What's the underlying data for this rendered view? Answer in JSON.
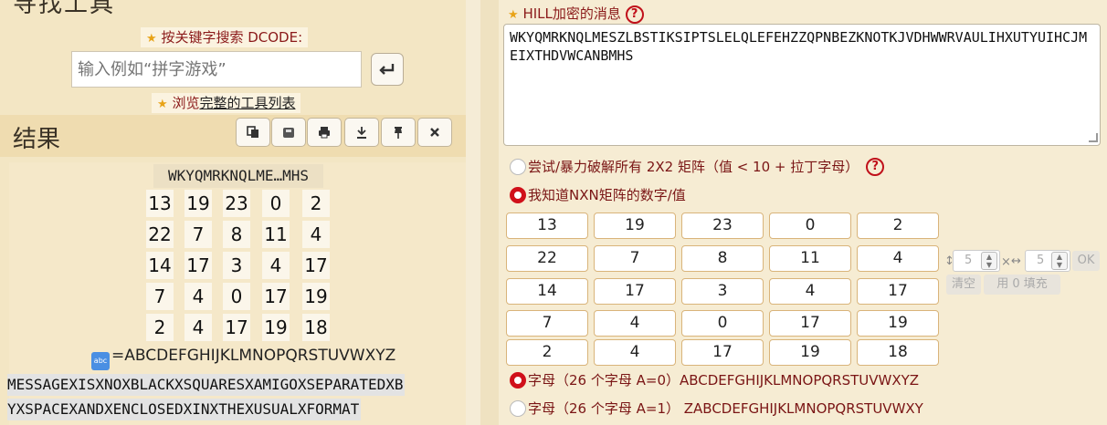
{
  "left": {
    "section_title": "寻找工具",
    "keyword_label": "按关键字搜索 DCODE:",
    "search_placeholder": "输入例如“拼字游戏”",
    "browse_prefix": "浏览",
    "browse_link": "完整的工具列表",
    "results_title": "结果",
    "result_header": "WKYQMRKNQLME…MHS",
    "matrix": [
      [
        "13",
        "19",
        "23",
        "0",
        "2"
      ],
      [
        "22",
        "7",
        "8",
        "11",
        "4"
      ],
      [
        "14",
        "17",
        "3",
        "4",
        "17"
      ],
      [
        "7",
        "4",
        "0",
        "17",
        "19"
      ],
      [
        "2",
        "4",
        "17",
        "19",
        "18"
      ]
    ],
    "alphabet_icon": "abc",
    "alphabet": "=ABCDEFGHIJKLMNOPQRSTUVWXYZ",
    "plain_line_1": "MESSAGEXISXNOXBLACKXSQUARESXAMIGOXSEPARATEDXB",
    "plain_line_2": "YXSPACEXANDXENCLOSEDXINXTHEXUSUALXFORMAT"
  },
  "right": {
    "cipher_label": "HILL加密的消息",
    "help_symbol": "?",
    "ciphertext": "WKYQMRKNQLMESZLBSTIKSIPTSLELQLEFEHZZQPNBEZKNOTKJVDHWWRVAULIHXUTYUIHCJMEIXTHDVWCANBMHS",
    "option_bruteforce": "尝试/暴力破解所有 2X2 矩阵（值 < 10 + 拉丁字母）",
    "option_known": "我知道NXN矩阵的数字/值",
    "matrix": [
      [
        "13",
        "19",
        "23",
        "0",
        "2"
      ],
      [
        "22",
        "7",
        "8",
        "11",
        "4"
      ],
      [
        "14",
        "17",
        "3",
        "4",
        "17"
      ],
      [
        "7",
        "4",
        "0",
        "17",
        "19"
      ],
      [
        "2",
        "4",
        "17",
        "19",
        "18"
      ]
    ],
    "rows_value": "5",
    "cols_value": "5",
    "ok_label": "OK",
    "times_symbol": "×",
    "clear_label": "清空",
    "fill_label": "用 0 填充",
    "alpha_a0": "字母（26 个字母 A=0）ABCDEFGHIJKLMNOPQRSTUVWXYZ",
    "alpha_a1": "字母（26 个字母 A=1） ZABCDEFGHIJKLMNOPQRSTUVWXY"
  },
  "colors": {
    "accent_red": "#c0101a",
    "label_red": "#8b1a1a",
    "star": "#e8a317",
    "bg": "#f5ecd6"
  }
}
